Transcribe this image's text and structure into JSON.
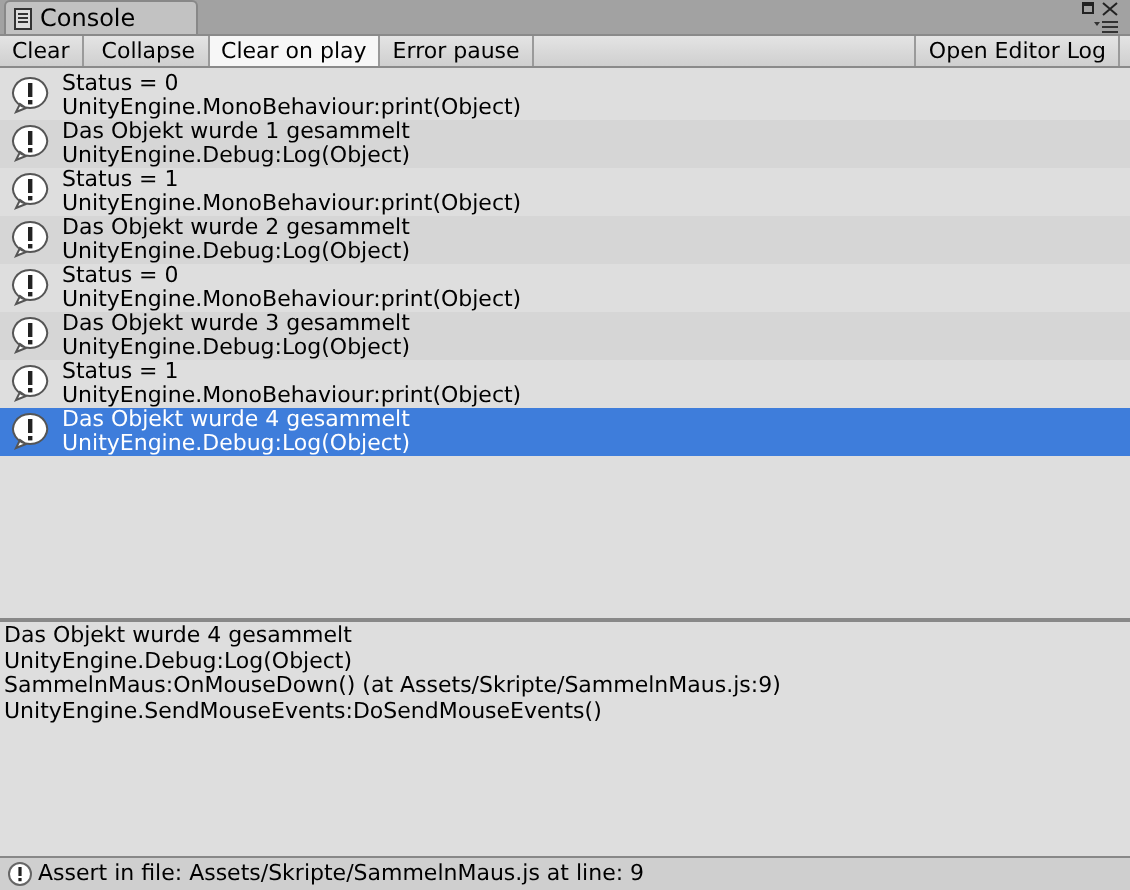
{
  "window": {
    "title": "Console"
  },
  "toolbar": {
    "buttons": [
      {
        "label": "Clear",
        "kind": "button"
      },
      {
        "label": "Collapse",
        "kind": "toggle",
        "on": false
      },
      {
        "label": "Clear on play",
        "kind": "toggle",
        "on": true
      },
      {
        "label": "Error pause",
        "kind": "toggle",
        "on": false
      }
    ],
    "right_button": "Open Editor Log"
  },
  "messages": [
    {
      "lines": [
        "Status = 0",
        "UnityEngine.MonoBehaviour:print(Object)"
      ],
      "selected": false
    },
    {
      "lines": [
        "Das Objekt wurde 1 gesammelt",
        "UnityEngine.Debug:Log(Object)"
      ],
      "selected": false
    },
    {
      "lines": [
        "Status = 1",
        "UnityEngine.MonoBehaviour:print(Object)"
      ],
      "selected": false
    },
    {
      "lines": [
        "Das Objekt wurde 2 gesammelt",
        "UnityEngine.Debug:Log(Object)"
      ],
      "selected": false
    },
    {
      "lines": [
        "Status = 0",
        "UnityEngine.MonoBehaviour:print(Object)"
      ],
      "selected": false
    },
    {
      "lines": [
        "Das Objekt wurde 3 gesammelt",
        "UnityEngine.Debug:Log(Object)"
      ],
      "selected": false
    },
    {
      "lines": [
        "Status = 1",
        "UnityEngine.MonoBehaviour:print(Object)"
      ],
      "selected": false
    },
    {
      "lines": [
        "Das Objekt wurde 4 gesammelt",
        "UnityEngine.Debug:Log(Object)"
      ],
      "selected": true
    }
  ],
  "details": [
    "Das Objekt wurde 4 gesammelt",
    "UnityEngine.Debug:Log(Object)",
    "SammelnMaus:OnMouseDown() (at Assets/Skripte/SammelnMaus.js:9)",
    "UnityEngine.SendMouseEvents:DoSendMouseEvents()"
  ],
  "status_bar": "Assert in file: Assets/Skripte/SammelnMaus.js at line: 9"
}
